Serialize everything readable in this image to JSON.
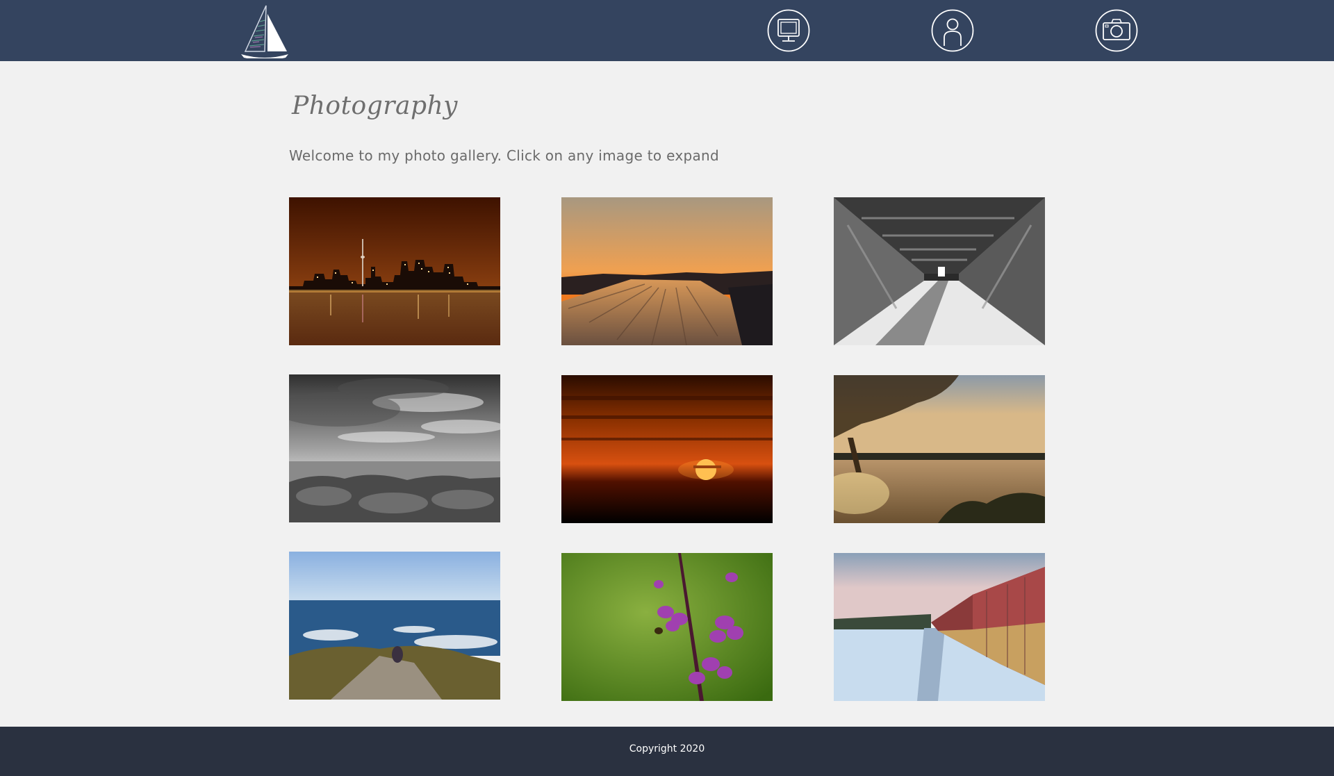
{
  "header": {
    "logo_icon": "sailboat-logo-icon",
    "nav": [
      {
        "icon": "computer-icon"
      },
      {
        "icon": "person-icon"
      },
      {
        "icon": "camera-icon"
      }
    ],
    "bg_color": "#34445f"
  },
  "main": {
    "title": "Photography",
    "intro": "Welcome to my photo gallery. Click on any image to expand",
    "bg_color": "#f1f1f1"
  },
  "gallery": {
    "photos": [
      {
        "subject": "city-skyline-night"
      },
      {
        "subject": "sunset-over-train"
      },
      {
        "subject": "covered-bridge-bw"
      },
      {
        "subject": "stormy-shore-bw"
      },
      {
        "subject": "sunset-over-water"
      },
      {
        "subject": "lake-tree-sunset"
      },
      {
        "subject": "ocean-rocks"
      },
      {
        "subject": "fireweed-flower"
      },
      {
        "subject": "train-snow"
      }
    ]
  },
  "footer": {
    "copyright": "Copyright 2020",
    "bg_color": "#2a3140"
  }
}
